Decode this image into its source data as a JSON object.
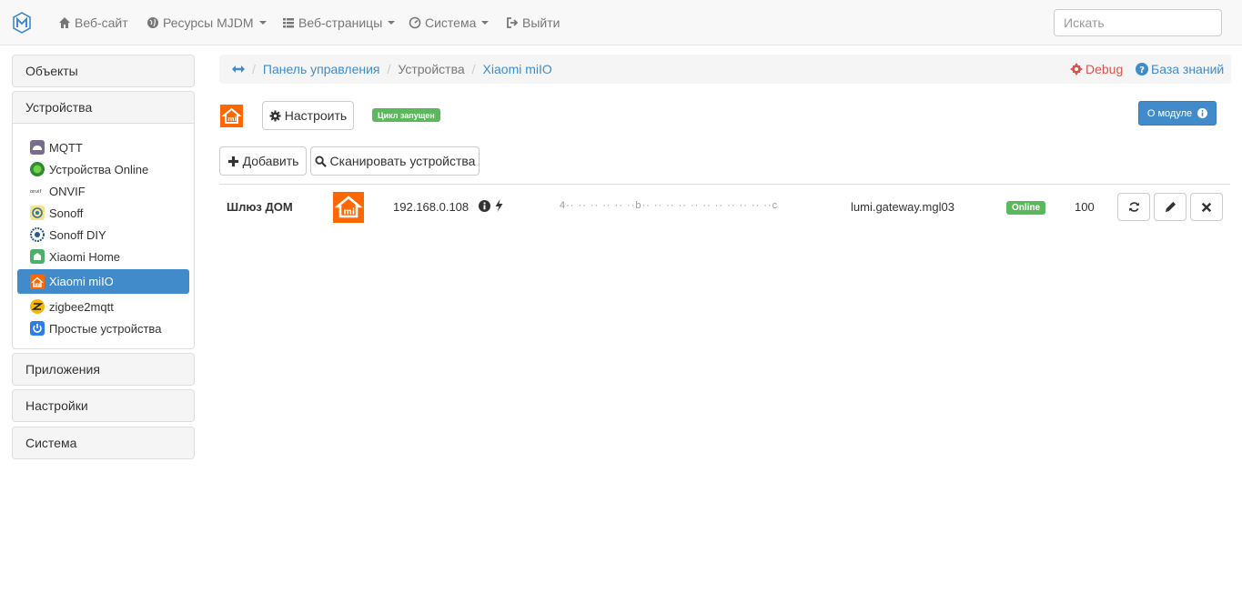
{
  "navbar": {
    "items": [
      {
        "label": "Веб-сайт",
        "icon": "home-icon"
      },
      {
        "label": "Ресурсы MJDM",
        "icon": "globe-icon"
      },
      {
        "label": "Веб-страницы",
        "icon": "list-icon"
      },
      {
        "label": "Система",
        "icon": "dashboard-icon"
      },
      {
        "label": "Выйти",
        "icon": "logout-icon"
      }
    ],
    "search_placeholder": "Искать"
  },
  "sidebar": {
    "sections": {
      "objects": "Объекты",
      "devices": "Устройства",
      "apps": "Приложения",
      "settings": "Настройки",
      "system": "Система"
    },
    "devices": [
      {
        "label": "MQTT",
        "icon": "mqtt-icon"
      },
      {
        "label": "Устройства Online",
        "icon": "online-devices-icon"
      },
      {
        "label": "ONVIF",
        "icon": "onvif-icon"
      },
      {
        "label": "Sonoff",
        "icon": "sonoff-icon"
      },
      {
        "label": "Sonoff DIY",
        "icon": "sonoff-diy-icon"
      },
      {
        "label": "Xiaomi Home",
        "icon": "xiaomi-home-icon"
      },
      {
        "label": "Xiaomi miIO",
        "icon": "xiaomi-miio-icon",
        "active": true
      },
      {
        "label": "zigbee2mqtt",
        "icon": "zigbee-icon"
      },
      {
        "label": "Простые устройства",
        "icon": "power-icon"
      }
    ]
  },
  "breadcrumb": {
    "items": [
      "Панель управления",
      "Устройства",
      "Xiaomi miIO"
    ],
    "debug": "Debug",
    "knowledge": "База знаний"
  },
  "toolbar": {
    "configure": "Настроить",
    "cycle_status": "Цикл запущен",
    "about": "О модуле",
    "add": "Добавить",
    "scan": "Сканировать устройства"
  },
  "table": {
    "rows": [
      {
        "name": "Шлюз ДОМ",
        "ip": "192.168.0.108",
        "token_masked": "4·· ·· ·· ·· ·· ··b·· ·· ·· ·· ·· ·· ·· ·· ·· ·· ··c",
        "model": "lumi.gateway.mgl03",
        "status": "Online",
        "value": "100"
      }
    ]
  },
  "colors": {
    "primary": "#428bca",
    "success": "#5cb85c",
    "danger": "#d9534f",
    "xiaomi": "#ff6700"
  }
}
